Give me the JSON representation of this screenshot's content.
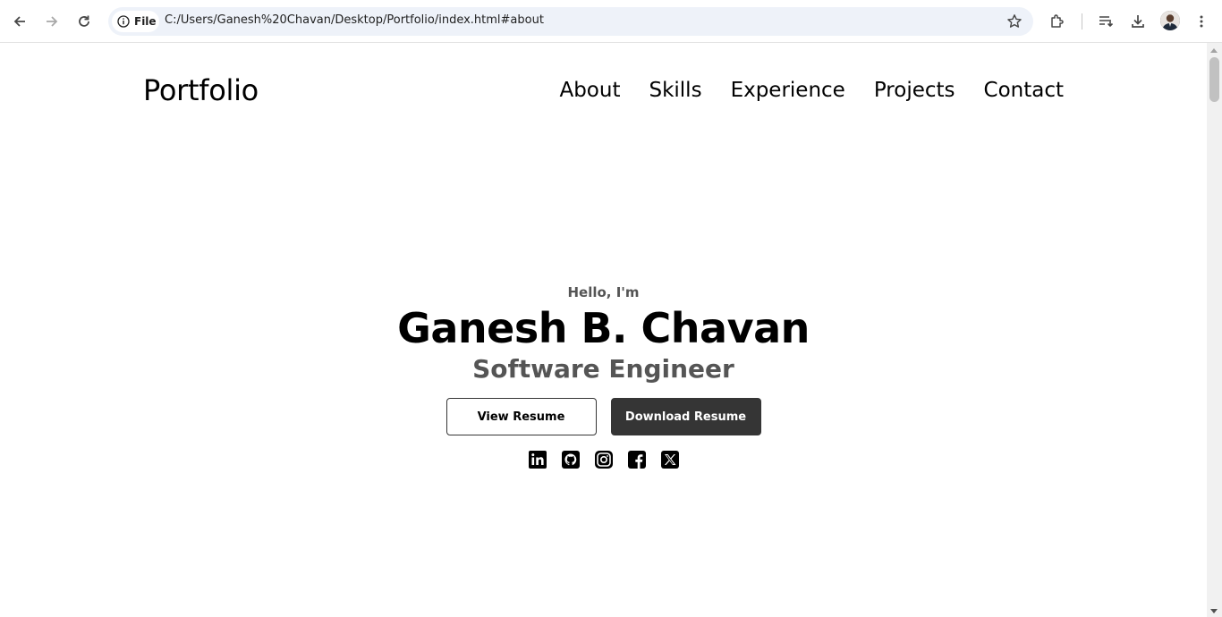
{
  "browser": {
    "chip_label": "File",
    "url": "C:/Users/Ganesh%20Chavan/Desktop/Portfolio/index.html#about",
    "icons": [
      "back-arrow-icon",
      "forward-arrow-icon",
      "reload-icon",
      "info-icon",
      "star-icon",
      "extensions-icon",
      "reading-list-icon",
      "download-icon",
      "profile-avatar",
      "more-menu-icon"
    ]
  },
  "header": {
    "logo": "Portfolio",
    "nav": [
      {
        "label": "About"
      },
      {
        "label": "Skills"
      },
      {
        "label": "Experience"
      },
      {
        "label": "Projects"
      },
      {
        "label": "Contact"
      }
    ]
  },
  "hero": {
    "greeting": "Hello, I'm",
    "name": "Ganesh B. Chavan",
    "role": "Software Engineer",
    "view_resume": "View Resume",
    "download_resume": "Download Resume",
    "socials": [
      "linkedin-icon",
      "github-icon",
      "instagram-icon",
      "facebook-icon",
      "x-icon"
    ]
  },
  "colors": {
    "text": "#000000",
    "muted": "#555555",
    "button_dark": "#353535",
    "omnibox": "#eef2f9"
  }
}
